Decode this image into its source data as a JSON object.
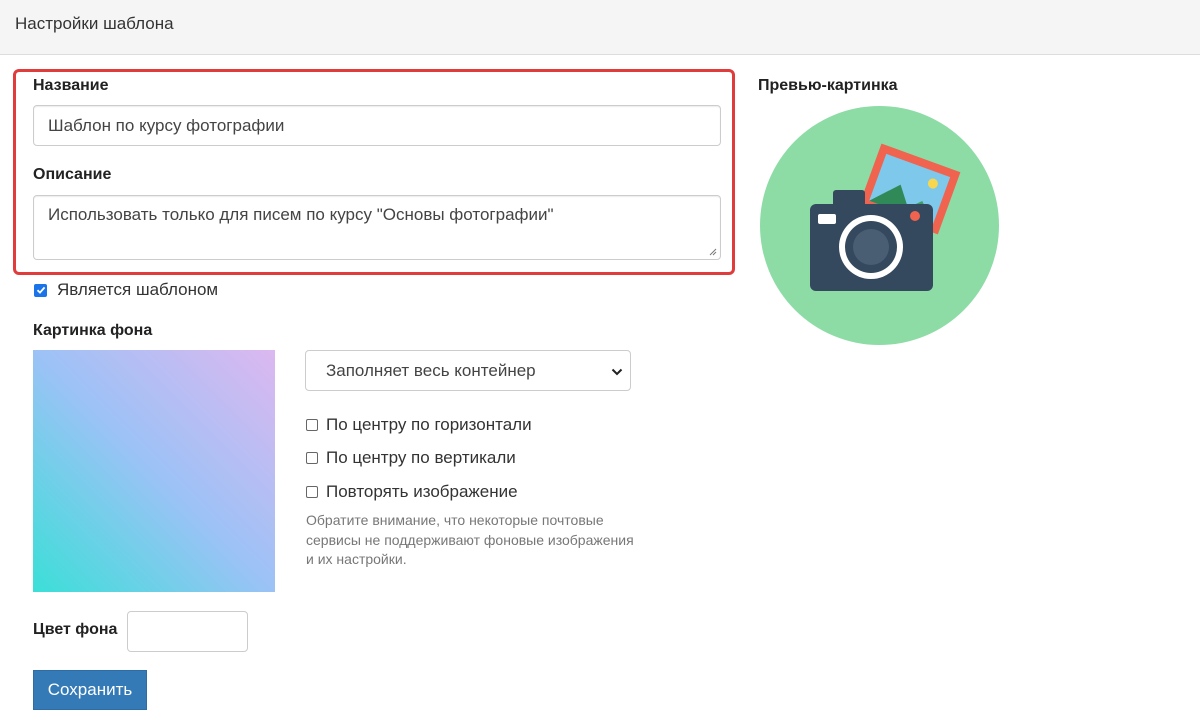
{
  "header": {
    "title": "Настройки шаблона"
  },
  "form": {
    "name_label": "Название",
    "name_value": "Шаблон по курсу фотографии",
    "description_label": "Описание",
    "description_value": "Использовать только для писем по курсу \"Основы фотографии\"",
    "is_template_label": "Является шаблоном",
    "is_template_checked": true
  },
  "background": {
    "image_label": "Картинка фона",
    "size_selected": "Заполняет весь контейнер",
    "center_horizontal_label": "По центру по горизонтали",
    "center_horizontal_checked": false,
    "center_vertical_label": "По центру по вертикали",
    "center_vertical_checked": false,
    "repeat_label": "Повторять изображение",
    "repeat_checked": false,
    "help_text": "Обратите внимание, что некоторые почтовые сервисы не поддерживают фоновые изображения и их настройки.",
    "color_label": "Цвет фона",
    "color_value": ""
  },
  "preview": {
    "label": "Превью-картинка"
  },
  "actions": {
    "save_label": "Сохранить"
  },
  "colors": {
    "highlight_border": "#e03c3c",
    "primary_button": "#337ab7",
    "preview_circle": "#8ddca6",
    "camera_body": "#34495e",
    "photo_frame": "#f0634f",
    "photo_sky": "#7ec8ec"
  }
}
